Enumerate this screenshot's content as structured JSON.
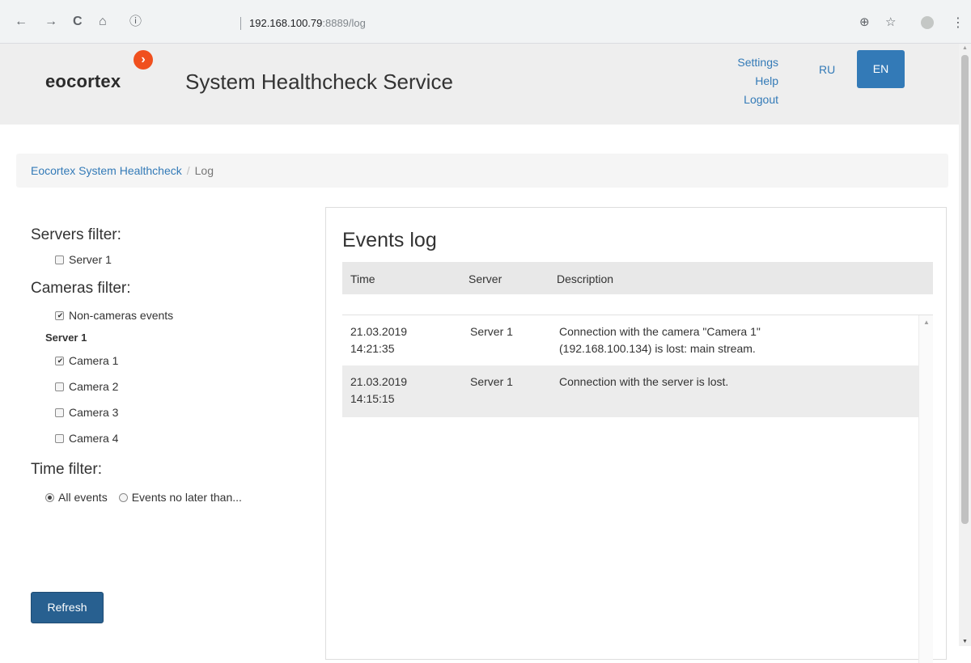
{
  "browser": {
    "back_icon": "←",
    "forward_icon": "→",
    "reload_icon": "C",
    "home_icon": "⌂",
    "info_icon": "ⓘ",
    "url_host": "192.168.100.79",
    "url_path": ":8889/log",
    "zoom_icon": "⊕",
    "star_icon": "☆",
    "menu_icon": "⋮"
  },
  "header": {
    "logo_text": "eocortex",
    "logo_mark": "›",
    "title": "System Healthcheck Service",
    "links": [
      "Settings",
      "Help",
      "Logout"
    ],
    "lang_ru": "RU",
    "lang_en": "EN",
    "accent_color": "#337ab7",
    "logo_color": "#f0501e"
  },
  "breadcrumb": {
    "home": "Eocortex System Healthcheck",
    "separator": "/",
    "current": "Log"
  },
  "filters": {
    "servers_heading": "Servers filter:",
    "servers": [
      {
        "label": "Server 1",
        "checked": false
      }
    ],
    "cameras_heading": "Cameras filter:",
    "non_cameras": {
      "label": "Non-cameras events",
      "checked": true
    },
    "group_label": "Server 1",
    "cameras": [
      {
        "label": "Camera 1",
        "checked": true
      },
      {
        "label": "Camera 2",
        "checked": false
      },
      {
        "label": "Camera 3",
        "checked": false
      },
      {
        "label": "Camera 4",
        "checked": false
      }
    ],
    "time_heading": "Time filter:",
    "time_options": [
      {
        "label": "All events",
        "checked": true
      },
      {
        "label": "Events no later than...",
        "checked": false
      }
    ],
    "refresh_label": "Refresh"
  },
  "events": {
    "title": "Events log",
    "columns": [
      "Time",
      "Server",
      "Description"
    ],
    "rows": [
      {
        "date": "21.03.2019",
        "time": "14:21:35",
        "server": "Server 1",
        "desc1": "Connection with the camera \"Camera 1\"",
        "desc2": "(192.168.100.134) is lost: main stream."
      },
      {
        "date": "21.03.2019",
        "time": "14:15:15",
        "server": "Server 1",
        "desc1": "Connection with the server is lost.",
        "desc2": ""
      }
    ]
  }
}
